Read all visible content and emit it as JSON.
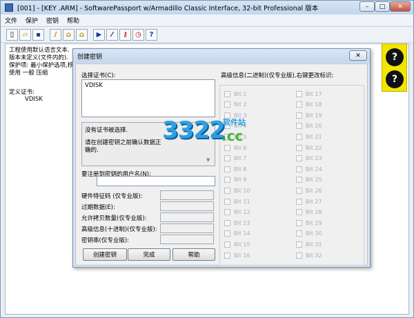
{
  "window": {
    "title": "[001] - [KEY .ARM] - SoftwarePassport w/Armadillo Classic Interface, 32-bit Professional 版本",
    "minimize_glyph": "–",
    "maximize_glyph": "□",
    "close_glyph": "✕"
  },
  "menu": [
    "文件",
    "保护",
    "密钥",
    "帮助"
  ],
  "toolbar": {
    "buttons": [
      {
        "icon": "new-file-icon",
        "glyph": "▯"
      },
      {
        "icon": "open-folder-icon",
        "glyph": "▱"
      },
      {
        "icon": "save-icon",
        "glyph": "▪"
      },
      {
        "icon": "pencil-icon",
        "glyph": "/"
      },
      {
        "icon": "lock-icon",
        "glyph": "⌂"
      },
      {
        "icon": "lock-key-icon",
        "glyph": "⌂"
      },
      {
        "icon": "play-icon",
        "glyph": "▶"
      },
      {
        "icon": "wand-icon",
        "glyph": "⁄"
      },
      {
        "icon": "key-icon",
        "glyph": "⚷"
      },
      {
        "icon": "clock-icon",
        "glyph": "◷"
      },
      {
        "icon": "help-icon",
        "glyph": "?"
      }
    ]
  },
  "main_text": [
    "工程使用默认语言文本.",
    "版本未定义(文件内的).",
    "保护项: 最小保护选项,移",
    "使用 一般 压缩",
    "",
    "定义证书:",
    "VDISK"
  ],
  "side_panel": {
    "help_glyph": "?",
    "bg": "#f2e600"
  },
  "dialog": {
    "title": "创建密钥",
    "close_glyph": "✕",
    "cert_label": "选择证书(C):",
    "cert_item": "VDISK",
    "status_line1": "没有证书被选择.",
    "status_line2": "请在创建密钥之前确认数据正",
    "status_line3": "确的.",
    "username_label": "要注册到密钥的用户名(N):",
    "fields": [
      "硬件特征码 (仅专业版):",
      "过期数据(E):",
      "允许拷贝数量(仅专业版):",
      "高级信息(十进制)(仅专业版):",
      "密钥串(仅专业版):"
    ],
    "bits_label": "高级信息(二进制)(仅专业版),右键更改标识:",
    "bits": [
      "Bit 1",
      "Bit 2",
      "Bit 3",
      "Bit 4",
      "Bit 5",
      "Bit 6",
      "Bit 7",
      "Bit 8",
      "Bit 9",
      "Bit 10",
      "Bit 11",
      "Bit 12",
      "Bit 13",
      "Bit 14",
      "Bit 15",
      "Bit 16",
      "Bit 17",
      "Bit 18",
      "Bit 19",
      "Bit 20",
      "Bit 21",
      "Bit 22",
      "Bit 23",
      "Bit 24",
      "Bit 25",
      "Bit 26",
      "Bit 27",
      "Bit 28",
      "Bit 29",
      "Bit 30",
      "Bit 31",
      "Bit 32"
    ],
    "buttons": {
      "create": "创建密钥",
      "done": "完成",
      "help": "帮助"
    }
  },
  "watermark": {
    "number": "3322",
    "top": "软件站",
    "domain": ".cc"
  }
}
